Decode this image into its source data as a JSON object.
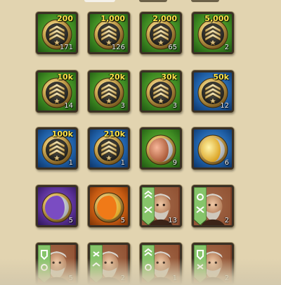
{
  "grid": {
    "row1": [
      {
        "amount": "200",
        "count": "171"
      },
      {
        "amount": "1,000",
        "count": "126"
      },
      {
        "amount": "2,000",
        "count": "65"
      },
      {
        "amount": "5,000",
        "count": "2"
      }
    ],
    "row2": [
      {
        "amount": "10k",
        "count": "14"
      },
      {
        "amount": "20k",
        "count": "3"
      },
      {
        "amount": "30k",
        "count": "3"
      },
      {
        "amount": "50k",
        "count": "12"
      }
    ],
    "row3": [
      {
        "amount": "100k",
        "count": "1"
      },
      {
        "amount": "210k",
        "count": "1"
      },
      {
        "count": "9"
      },
      {
        "count": "6"
      }
    ],
    "row4": [
      {
        "count": "5"
      },
      {
        "count": "5"
      },
      {
        "count": "13"
      },
      {
        "count": "2"
      }
    ],
    "row5": [
      {
        "count": "5"
      },
      {
        "count": "2"
      },
      {
        "count": "1"
      },
      {
        "count": "2"
      }
    ]
  },
  "colors": {
    "green": "#3e8a22",
    "blue": "#1f5fa6",
    "purple": "#5a3198",
    "orange": "#c55a12",
    "amount_text": "#ffe54a",
    "background": "#e2d4b0"
  }
}
